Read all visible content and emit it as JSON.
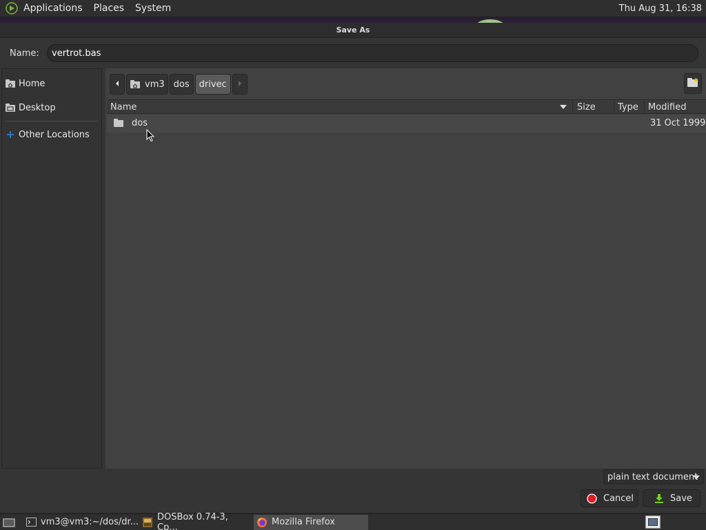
{
  "top_panel": {
    "menus": [
      "Applications",
      "Places",
      "System"
    ],
    "clock": "Thu Aug 31, 16:38"
  },
  "dialog": {
    "title": "Save As",
    "name_label": "Name:",
    "filename": "vertrot.bas",
    "sidebar": {
      "items": [
        {
          "label": "Home",
          "icon": "home-folder-icon"
        },
        {
          "label": "Desktop",
          "icon": "desktop-folder-icon"
        },
        {
          "label": "Other Locations",
          "icon": "plus-icon"
        }
      ]
    },
    "pathbar": {
      "segments": [
        "vm3",
        "dos",
        "drivec"
      ],
      "active": "drivec"
    },
    "columns": {
      "name": "Name",
      "size": "Size",
      "type": "Type",
      "modified": "Modified"
    },
    "files": [
      {
        "name": "dos",
        "size": "",
        "type": "",
        "modified": "31 Oct 1999",
        "icon": "folder-icon"
      }
    ],
    "filter": "plain text document",
    "buttons": {
      "cancel": "Cancel",
      "save": "Save"
    }
  },
  "taskbar": {
    "tasks": [
      {
        "label": "vm3@vm3:~/dos/dr...",
        "icon": "terminal-icon",
        "active": false
      },
      {
        "label": "DOSBox 0.74-3, Cp...",
        "icon": "dosbox-icon",
        "active": false
      },
      {
        "label": "Mozilla Firefox",
        "icon": "firefox-icon",
        "active": true
      }
    ]
  },
  "colors": {
    "accent_blue": "#2a76c6",
    "cancel_red": "#e01b24",
    "save_green": "#73d216",
    "desktop_purple": "#2a1f36"
  }
}
